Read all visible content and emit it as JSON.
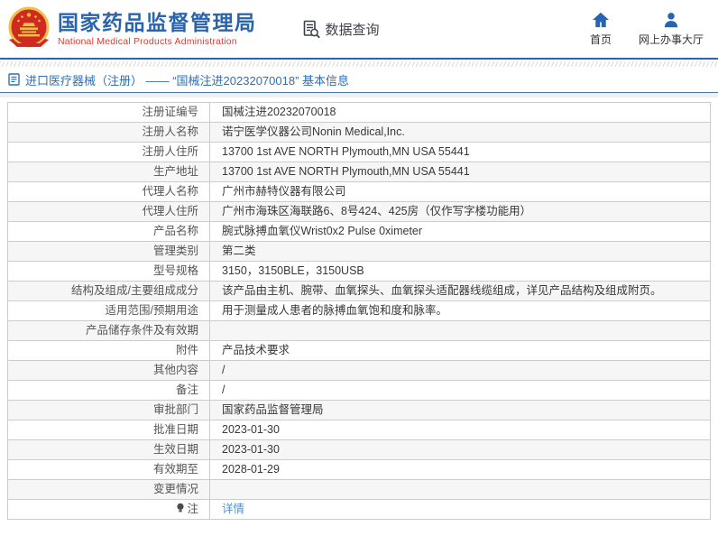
{
  "header": {
    "title": "国家药品监督管理局",
    "subtitle": "National Medical Products Administration",
    "data_query_label": "数据查询",
    "nav": {
      "home_label": "首页",
      "hall_label": "网上办事大厅"
    }
  },
  "breadcrumb": {
    "text": "进口医疗器械（注册） —— “国械注进20232070018” 基本信息"
  },
  "table": {
    "rows": [
      {
        "label": "注册证编号",
        "value": "国械注进20232070018"
      },
      {
        "label": "注册人名称",
        "value": "诺宁医学仪器公司Nonin Medical,Inc."
      },
      {
        "label": "注册人住所",
        "value": "13700 1st AVE NORTH Plymouth,MN USA 55441"
      },
      {
        "label": "生产地址",
        "value": "13700 1st AVE NORTH Plymouth,MN USA 55441"
      },
      {
        "label": "代理人名称",
        "value": "广州市赫特仪器有限公司"
      },
      {
        "label": "代理人住所",
        "value": "广州市海珠区海联路6、8号424、425房（仅作写字楼功能用）"
      },
      {
        "label": "产品名称",
        "value": "腕式脉搏血氧仪Wrist0x2 Pulse 0ximeter"
      },
      {
        "label": "管理类别",
        "value": "第二类"
      },
      {
        "label": "型号规格",
        "value": "3150，3150BLE，3150USB"
      },
      {
        "label": "结构及组成/主要组成成分",
        "value": "该产品由主机、腕带、血氧探头、血氧探头适配器线缆组成，详见产品结构及组成附页。"
      },
      {
        "label": "适用范围/预期用途",
        "value": "用于测量成人患者的脉搏血氧饱和度和脉率。"
      },
      {
        "label": "产品储存条件及有效期",
        "value": ""
      },
      {
        "label": "附件",
        "value": "产品技术要求"
      },
      {
        "label": "其他内容",
        "value": "/"
      },
      {
        "label": "备注",
        "value": "/"
      },
      {
        "label": "审批部门",
        "value": "国家药品监督管理局"
      },
      {
        "label": "批准日期",
        "value": "2023-01-30"
      },
      {
        "label": "生效日期",
        "value": "2023-01-30"
      },
      {
        "label": "有效期至",
        "value": "2028-01-29"
      },
      {
        "label": "变更情况",
        "value": ""
      },
      {
        "label": "注",
        "value": "详情"
      }
    ]
  },
  "colors": {
    "brand_blue": "#2a64ad",
    "brand_red": "#e03a33",
    "link_blue": "#4a90d9",
    "row_stripe": "#f6f6f6",
    "border_gray": "#cccccc"
  }
}
